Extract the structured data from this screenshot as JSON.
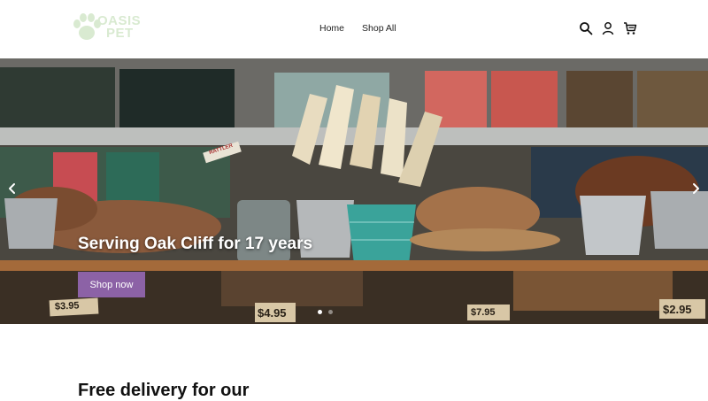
{
  "brand": {
    "logo_text_line1": "OASIS",
    "logo_text_line2": "PET"
  },
  "nav": {
    "items": [
      {
        "label": "Home"
      },
      {
        "label": "Shop All"
      }
    ]
  },
  "header_icons": [
    "search-icon",
    "account-icon",
    "cart-icon"
  ],
  "hero": {
    "title": "Serving Oak Cliff for 17 years",
    "button_label": "Shop now",
    "slides_count": 2,
    "active_slide": 1,
    "price_tags": [
      "$3.95",
      "$4.95",
      "$7.95",
      "$2.95"
    ],
    "shelf_labels": [
      "RATTLER"
    ]
  },
  "section": {
    "heading": "Free delivery for our"
  },
  "colors": {
    "accent": "#8c62a6",
    "logo": "#d9ead1",
    "header_bg": "#ffffff"
  }
}
